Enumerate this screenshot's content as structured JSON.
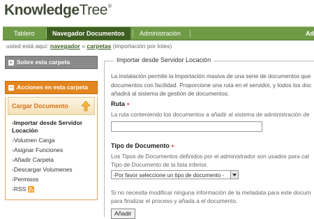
{
  "logo": {
    "part1": "Knowledge",
    "part2": "Tree",
    "mark": "®"
  },
  "nav": {
    "tabs": [
      {
        "label": "Tablero"
      },
      {
        "label": "Navegador Documentos",
        "active": true
      },
      {
        "label": "Administración"
      },
      {
        "label": "Ad"
      }
    ]
  },
  "breadcrumb": {
    "prefix": "usted está aquí:",
    "link1": "navegador",
    "sep": "»",
    "link2": "carpetas",
    "suffix": "(importación por lotes)"
  },
  "sidebar": {
    "about_header": "Sobre esta carpeta",
    "actions_header": "Acciones en esta carpeta",
    "upload_label": "Cargar Documento",
    "menu": [
      {
        "label": "Importar desde Servidor Locación",
        "current": true
      },
      {
        "label": "Volumen Carga"
      },
      {
        "label": "Asignar Funciones"
      },
      {
        "label": "Añadir Carpeta"
      },
      {
        "label": "Descargar Volumenes"
      },
      {
        "label": "Permisos"
      },
      {
        "label": "RSS"
      }
    ]
  },
  "main": {
    "legend": "Importar desde Servidor Locación",
    "desc_lines": [
      "La instalación permite la importación masiva de una serie de documentos que",
      "documentos con facilidad. Proporcione una ruta en el servidor, y todos los doc",
      "añadirá al sistema de gestión de documentos."
    ],
    "ruta_label": "Ruta",
    "ruta_help": "La ruta conteniendo los documentos a añadir al sistema de administración de",
    "ruta_value": "",
    "tipo_label": "Tipo de Documento",
    "tipo_help_lines": [
      "Los Tipos de Documentos definidos por el administrador son usados para cat",
      "Tipo de Documento de la lista inferior."
    ],
    "tipo_select": "-Por favor seleccione un tipo de documento -",
    "note_lines": [
      "Si no necesita modificar ninguna información de la metadata para este docum",
      "para finalizar el proceso y añada a el documento."
    ],
    "add_button": "Añadir",
    "required_mark": "•"
  },
  "colors": {
    "nav_green": "#6f9b47",
    "nav_active": "#3f5f23",
    "orange": "#e3861f",
    "gray_header": "#8a8a8a"
  }
}
